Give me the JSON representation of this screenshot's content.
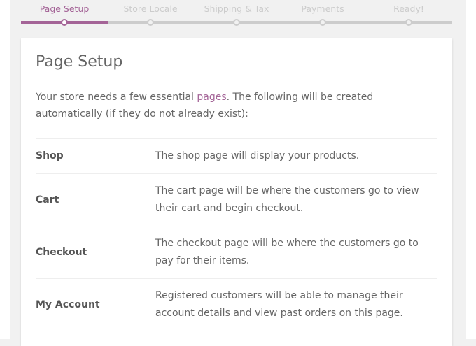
{
  "steps": [
    {
      "label": "Page Setup",
      "active": true
    },
    {
      "label": "Store Locale",
      "active": false
    },
    {
      "label": "Shipping & Tax",
      "active": false
    },
    {
      "label": "Payments",
      "active": false
    },
    {
      "label": "Ready!",
      "active": false
    }
  ],
  "colors": {
    "accent": "#a46497",
    "inactive": "#cccccc",
    "text": "#666666"
  },
  "card": {
    "title": "Page Setup",
    "intro_before": "Your store needs a few essential ",
    "intro_link": "pages",
    "intro_after": ". The following will be created automatically (if they do not already exist):",
    "pages": [
      {
        "name": "Shop",
        "description": "The shop page will display your products."
      },
      {
        "name": "Cart",
        "description": "The cart page will be where the customers go to view their cart and begin checkout."
      },
      {
        "name": "Checkout",
        "description": "The checkout page will be where the customers go to pay for their items."
      },
      {
        "name": "My Account",
        "description": "Registered customers will be able to manage their account details and view past orders on this page."
      }
    ]
  }
}
